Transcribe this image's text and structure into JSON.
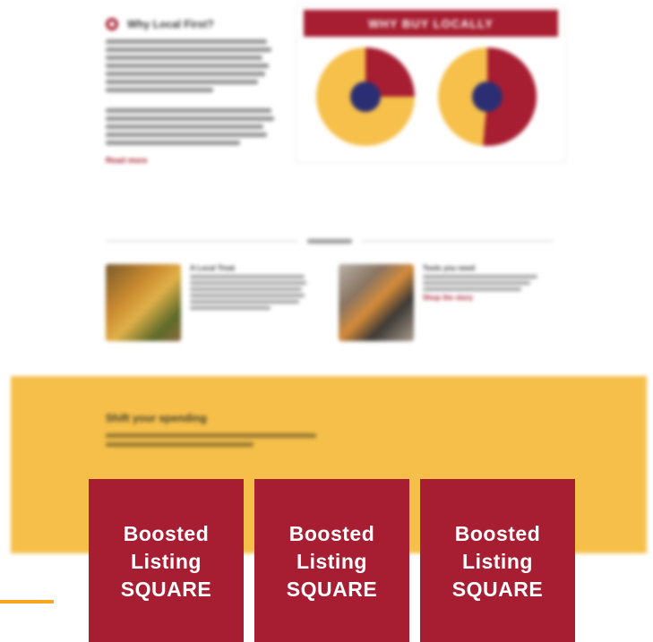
{
  "why_local": {
    "title": "Why Local First?",
    "link": "Read more"
  },
  "charts_panel": {
    "header": "WHY BUY LOCALLY",
    "colors": {
      "primary": "#a71d31",
      "secondary": "#f6c04b",
      "center": "#2c2e73"
    }
  },
  "articles": [
    {
      "title": "A Local Treat",
      "link": "Read more",
      "image": "food-photo"
    },
    {
      "title": "Tools you need",
      "link": "Shop the story",
      "image": "tools-photo"
    }
  ],
  "band": {
    "title": "Shift your spending",
    "color": "#f6bf4a"
  },
  "boosted": [
    {
      "line1": "Boosted",
      "line2": "Listing",
      "line3": "SQUARE"
    },
    {
      "line1": "Boosted",
      "line2": "Listing",
      "line3": "SQUARE"
    },
    {
      "line1": "Boosted",
      "line2": "Listing",
      "line3": "SQUARE"
    }
  ],
  "accent_colors": {
    "brand_red": "#a71d31",
    "accent_orange": "#f6a623"
  }
}
